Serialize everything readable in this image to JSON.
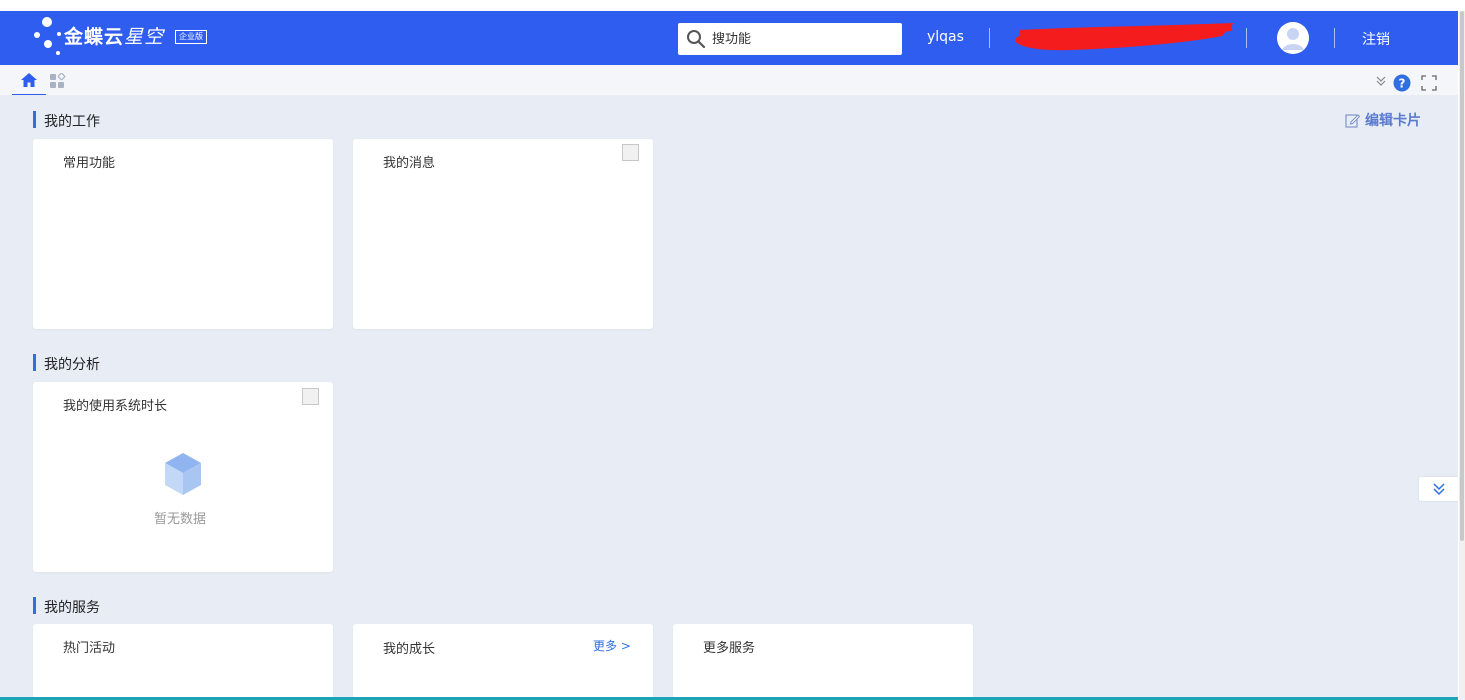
{
  "header": {
    "logo_brand": "金蝶云",
    "logo_product": "星空",
    "logo_edition": "企业版",
    "search_placeholder": "搜功能",
    "username": "ylqas",
    "logout_label": "注销"
  },
  "toolbar": {
    "edit_cards_label": "编辑卡片"
  },
  "sections": [
    {
      "title": "我的工作",
      "cards": [
        {
          "title": "常用功能"
        },
        {
          "title": "我的消息"
        }
      ]
    },
    {
      "title": "我的分析",
      "cards": [
        {
          "title": "我的使用系统时长",
          "empty_text": "暂无数据"
        }
      ]
    },
    {
      "title": "我的服务",
      "cards": [
        {
          "title": "热门活动"
        },
        {
          "title": "我的成长",
          "more_label": "更多 >"
        },
        {
          "title": "更多服务"
        }
      ]
    }
  ],
  "colors": {
    "header_bg": "#2f5df0",
    "content_bg": "#e7ecf5",
    "accent": "#2f6fe0"
  },
  "icons": {
    "home": "home-icon",
    "apps": "apps-icon",
    "search": "search-icon",
    "help": "help-icon",
    "fullscreen": "fullscreen-icon",
    "collapse": "double-chevron-down-icon"
  }
}
